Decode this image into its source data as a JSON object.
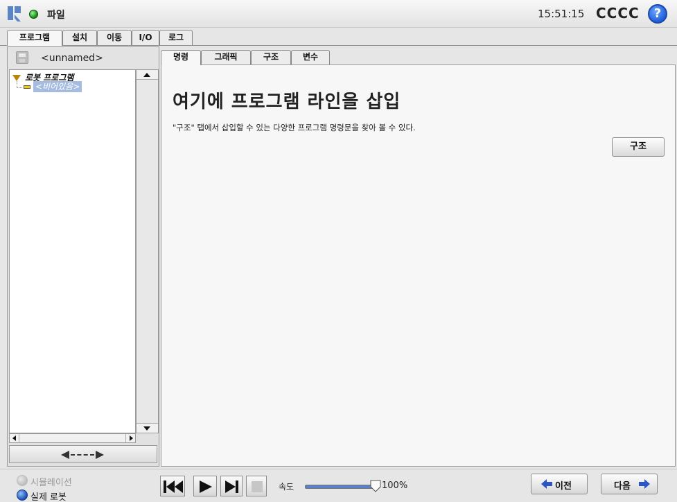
{
  "topbar": {
    "menu_label": "파일",
    "clock": "15:51:15",
    "robot_name": "CCCC",
    "help_symbol": "?",
    "status_color": "#1c9a1c"
  },
  "main_tabs": [
    {
      "label": "프로그램",
      "active": true
    },
    {
      "label": "설치",
      "active": false
    },
    {
      "label": "이동",
      "active": false
    },
    {
      "label": "I/O",
      "active": false
    },
    {
      "label": "로그",
      "active": false
    }
  ],
  "left_panel": {
    "file_name": "<unnamed>",
    "tree_root": "로봇 프로그램",
    "tree_child": "<비어있음>"
  },
  "sub_tabs": [
    {
      "label": "명령",
      "active": true
    },
    {
      "label": "그래픽",
      "active": false
    },
    {
      "label": "구조",
      "active": false
    },
    {
      "label": "변수",
      "active": false
    }
  ],
  "command_panel": {
    "heading": "여기에 프로그램 라인을 삽입",
    "description": "\"구조\" 탭에서 삽입할 수 있는 다양한 프로그램 명령문을 찾아 볼 수 있다.",
    "structure_button": "구조"
  },
  "bottombar": {
    "simulation_label": "시뮬레이션",
    "real_robot_label": "실제 로봇",
    "speed_label": "속도",
    "speed_value": "100%",
    "speed_fraction": 1.0,
    "prev_label": "이전",
    "next_label": "다음"
  },
  "icons": [
    "ur-logo-icon",
    "status-dot-icon",
    "help-icon",
    "floppy-icon",
    "rewind-icon",
    "play-icon",
    "step-icon",
    "stop-icon",
    "arrow-left-icon",
    "arrow-right-icon"
  ]
}
